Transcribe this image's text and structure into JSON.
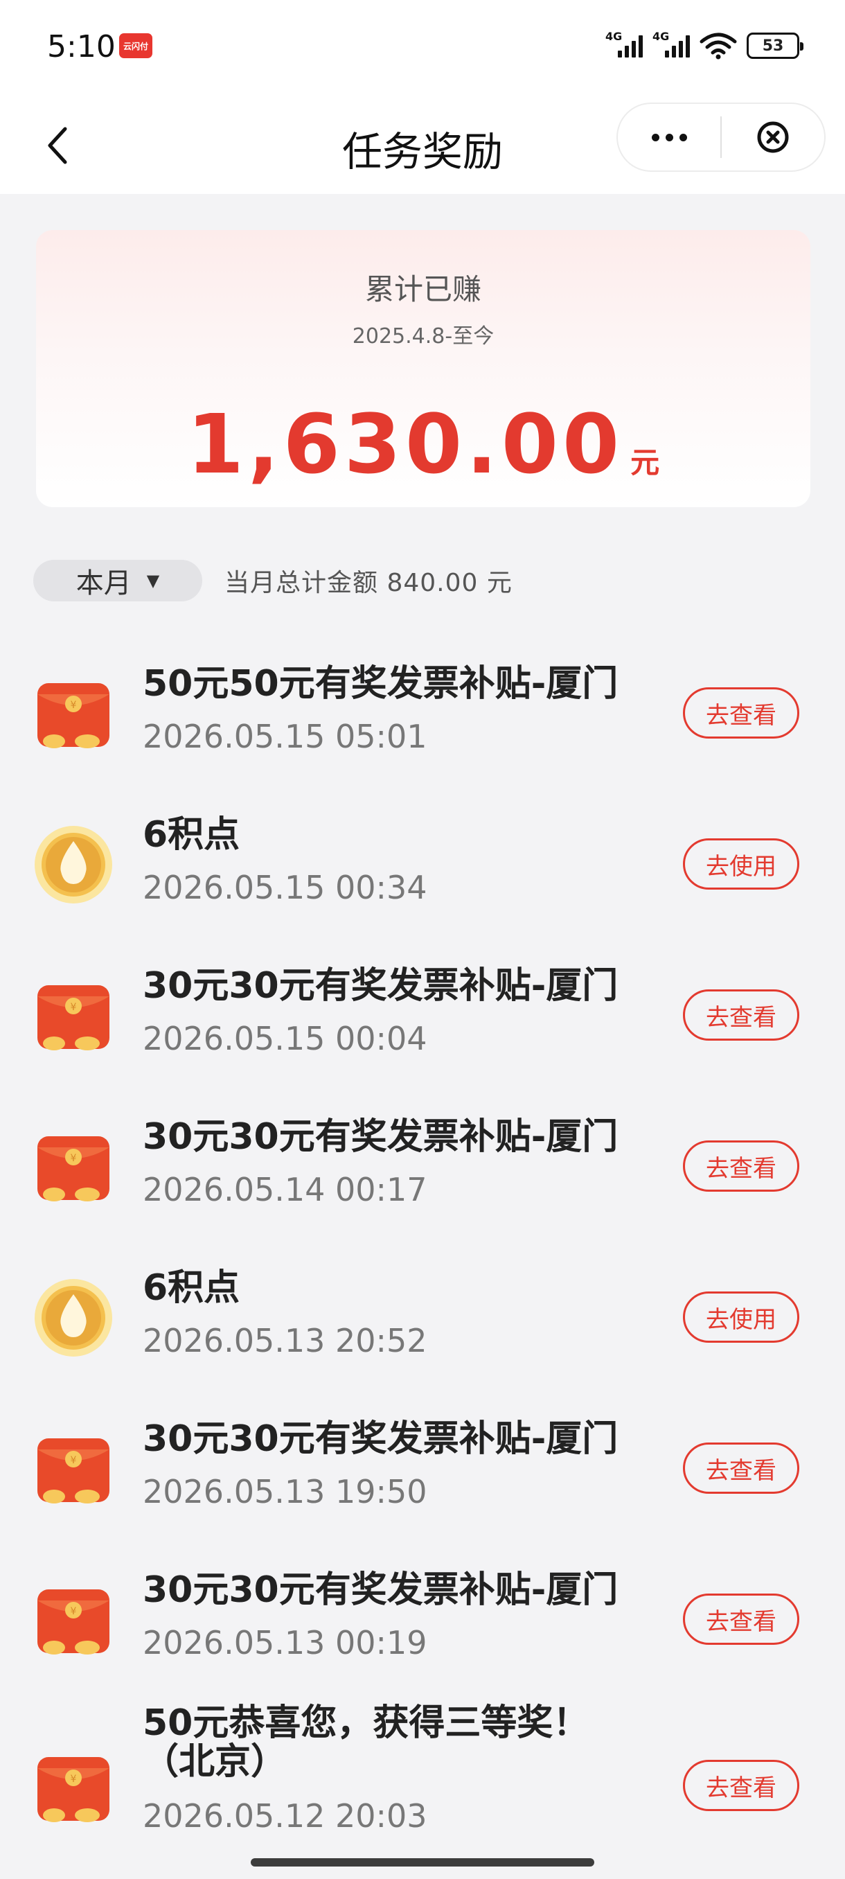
{
  "status_bar": {
    "time": "5:10",
    "app_badge": "云闪付",
    "signal_1_label": "4G",
    "signal_2_label": "4G",
    "battery": "53"
  },
  "nav": {
    "title": "任务奖励",
    "more_icon": "more-dots-icon",
    "close_icon": "close-circle-icon",
    "back_icon": "chevron-left-icon"
  },
  "earned": {
    "label": "累计已赚",
    "period": "2025.4.8-至今",
    "amount": "1,630.00",
    "unit": "元"
  },
  "filter": {
    "month": "本月",
    "caret": "▼",
    "total": "当月总计金额 840.00 元"
  },
  "colors": {
    "accent": "#e33a2f",
    "background": "#f3f3f5"
  },
  "rewards": [
    {
      "icon": "red-envelope-icon",
      "title": "50元50元有奖发票补贴-厦门",
      "time": "2026.05.15 05:01",
      "action": "去查看"
    },
    {
      "icon": "points-drop-icon",
      "title": "6积点",
      "time": "2026.05.15 00:34",
      "action": "去使用"
    },
    {
      "icon": "red-envelope-icon",
      "title": "30元30元有奖发票补贴-厦门",
      "time": "2026.05.15 00:04",
      "action": "去查看"
    },
    {
      "icon": "red-envelope-icon",
      "title": "30元30元有奖发票补贴-厦门",
      "time": "2026.05.14 00:17",
      "action": "去查看"
    },
    {
      "icon": "points-drop-icon",
      "title": "6积点",
      "time": "2026.05.13 20:52",
      "action": "去使用"
    },
    {
      "icon": "red-envelope-icon",
      "title": "30元30元有奖发票补贴-厦门",
      "time": "2026.05.13 19:50",
      "action": "去查看"
    },
    {
      "icon": "red-envelope-icon",
      "title": "30元30元有奖发票补贴-厦门",
      "time": "2026.05.13 00:19",
      "action": "去查看"
    },
    {
      "icon": "red-envelope-icon",
      "title": "50元恭喜您，获得三等奖！",
      "title_line2": "（北京）",
      "time": "2026.05.12 20:03",
      "action": "去查看"
    }
  ]
}
